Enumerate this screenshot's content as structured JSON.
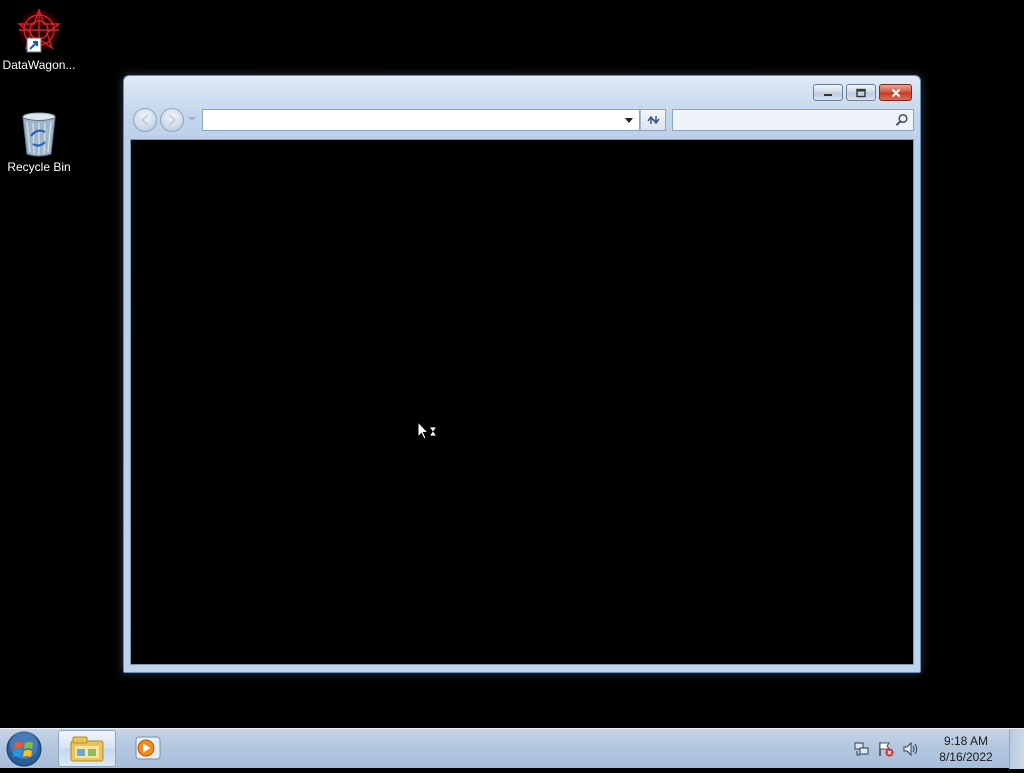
{
  "desktop": {
    "icons": [
      {
        "label": "DataWagon...",
        "icon": "datawagon-app-icon"
      },
      {
        "label": "Recycle Bin",
        "icon": "recycle-bin-icon"
      }
    ]
  },
  "window": {
    "address": {
      "value": "",
      "placeholder": ""
    },
    "search": {
      "value": "",
      "placeholder": ""
    },
    "caption_buttons": [
      "minimize",
      "maximize",
      "close"
    ]
  },
  "taskbar": {
    "items": [
      {
        "icon": "windows-explorer-icon",
        "active": true
      },
      {
        "icon": "windows-media-player-icon",
        "active": false
      }
    ],
    "tray_icons": [
      "network-icon",
      "action-center-flag-icon",
      "volume-icon"
    ],
    "clock": {
      "time": "9:18 AM",
      "date": "8/16/2022"
    }
  },
  "colors": {
    "desktop_bg": "#000000",
    "window_frame": "#bfd3ea",
    "close_button": "#c23a23",
    "taskbar": "#b3c7df"
  }
}
